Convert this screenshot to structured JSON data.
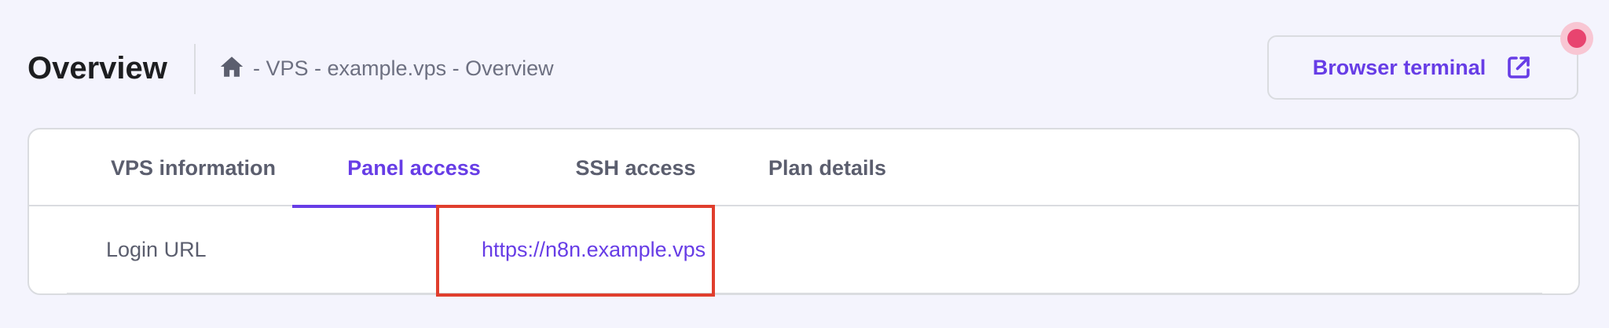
{
  "header": {
    "title": "Overview",
    "breadcrumb": {
      "icon": "home-icon",
      "text": "- VPS - example.vps - Overview"
    },
    "terminal_button": {
      "label": "Browser terminal",
      "icon": "external-link-icon"
    }
  },
  "tabs": [
    {
      "label": "VPS information",
      "active": false
    },
    {
      "label": "Panel access",
      "active": true
    },
    {
      "label": "SSH access",
      "active": false
    },
    {
      "label": "Plan details",
      "active": false
    }
  ],
  "panel_access": {
    "rows": [
      {
        "label": "Login URL",
        "value": "https://n8n.example.vps"
      }
    ]
  },
  "colors": {
    "accent": "#673de6",
    "background": "#f4f4fd",
    "highlight": "#e03e2d",
    "notification": "#e8446f"
  }
}
